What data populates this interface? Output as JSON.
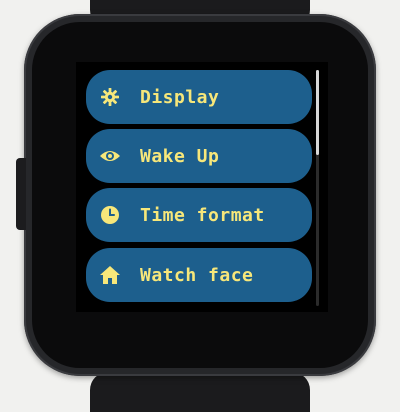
{
  "menu": {
    "items": [
      {
        "label": "Display",
        "icon": "gear-icon"
      },
      {
        "label": "Wake Up",
        "icon": "eye-icon"
      },
      {
        "label": "Time format",
        "icon": "clock-icon"
      },
      {
        "label": "Watch face",
        "icon": "home-icon"
      }
    ]
  },
  "colors": {
    "item_background": "#1d5f8d",
    "accent_text": "#f7e77a",
    "screen_background": "#000000"
  },
  "scroll": {
    "position_fraction": 0.0,
    "visible_fraction": 0.36
  }
}
